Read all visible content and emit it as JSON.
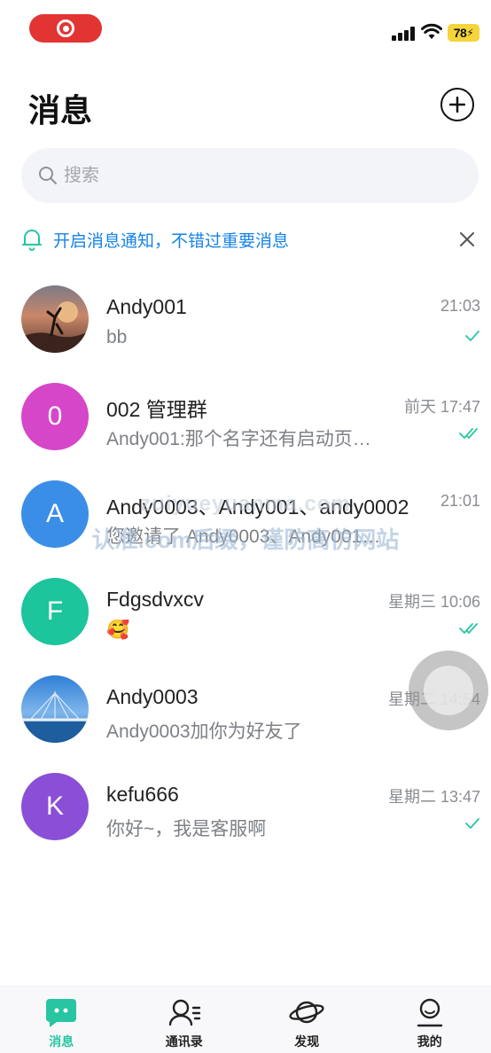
{
  "status_bar": {
    "battery": "78"
  },
  "header": {
    "title": "消息"
  },
  "search": {
    "placeholder": "搜索"
  },
  "notice": {
    "text": "开启消息通知，不错过重要消息"
  },
  "chats": [
    {
      "name": "Andy001",
      "time": "21:03",
      "preview": "bb",
      "avatar_letter": "",
      "read_status": "sent"
    },
    {
      "name": "002 管理群",
      "time": "前天 17:47",
      "preview": "Andy001:那个名字还有启动页…",
      "avatar_letter": "0",
      "read_status": "read"
    },
    {
      "name": "Andy0003、Andy001、andy0002",
      "time": "21:01",
      "preview": "您邀请了 Andy0003、Andy001…",
      "avatar_letter": "A",
      "read_status": ""
    },
    {
      "name": "Fdgsdvxcv",
      "time": "星期三 10:06",
      "preview": "🥰",
      "avatar_letter": "F",
      "read_status": "read"
    },
    {
      "name": "Andy0003",
      "time": "星期二 14:54",
      "preview": "Andy0003加你为好友了",
      "avatar_letter": "",
      "read_status": ""
    },
    {
      "name": "kefu666",
      "time": "星期二 13:47",
      "preview": "你好~，我是客服啊",
      "avatar_letter": "K",
      "read_status": "sent"
    }
  ],
  "watermark": {
    "url": "zuiyueyuanma.com",
    "text": "认准.com后缀，谨防高仿网站"
  },
  "tabs": [
    {
      "label": "消息",
      "icon": "chat-bubble-icon",
      "active": true
    },
    {
      "label": "通讯录",
      "icon": "contacts-icon",
      "active": false
    },
    {
      "label": "发现",
      "icon": "planet-icon",
      "active": false
    },
    {
      "label": "我的",
      "icon": "profile-icon",
      "active": false
    }
  ],
  "colors": {
    "accent": "#27c5a1",
    "notice_blue": "#1583e6",
    "avatar_0": "#d646c8",
    "avatar_A": "#3b8ee8",
    "avatar_F": "#1cc59c",
    "avatar_K": "#8a4fd6"
  }
}
